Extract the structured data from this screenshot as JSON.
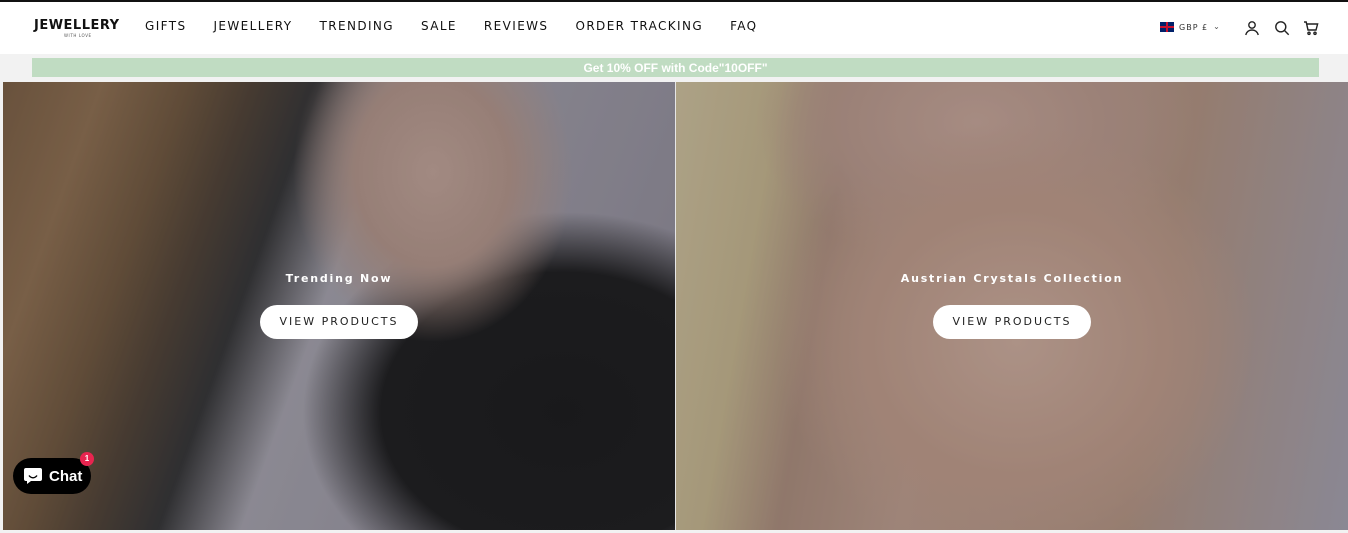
{
  "brand": {
    "name": "JEWELLERY",
    "tagline": "WITH LOVE"
  },
  "nav": {
    "items": [
      {
        "label": "GIFTS"
      },
      {
        "label": "JEWELLERY"
      },
      {
        "label": "TRENDING"
      },
      {
        "label": "SALE"
      },
      {
        "label": "REVIEWS"
      },
      {
        "label": "ORDER TRACKING"
      },
      {
        "label": "FAQ"
      }
    ]
  },
  "header": {
    "currency": "GBP £",
    "icons": [
      "account-icon",
      "search-icon",
      "cart-icon"
    ]
  },
  "promo": {
    "text": "Get 10% OFF with Code\"10OFF\"",
    "color": "#c0dcc2"
  },
  "heroes": [
    {
      "title": "Trending Now",
      "button": "VIEW PRODUCTS"
    },
    {
      "title": "Austrian Crystals Collection",
      "button": "VIEW PRODUCTS"
    }
  ],
  "chat": {
    "label": "Chat",
    "badge": "1",
    "badge_color": "#e8244f"
  }
}
